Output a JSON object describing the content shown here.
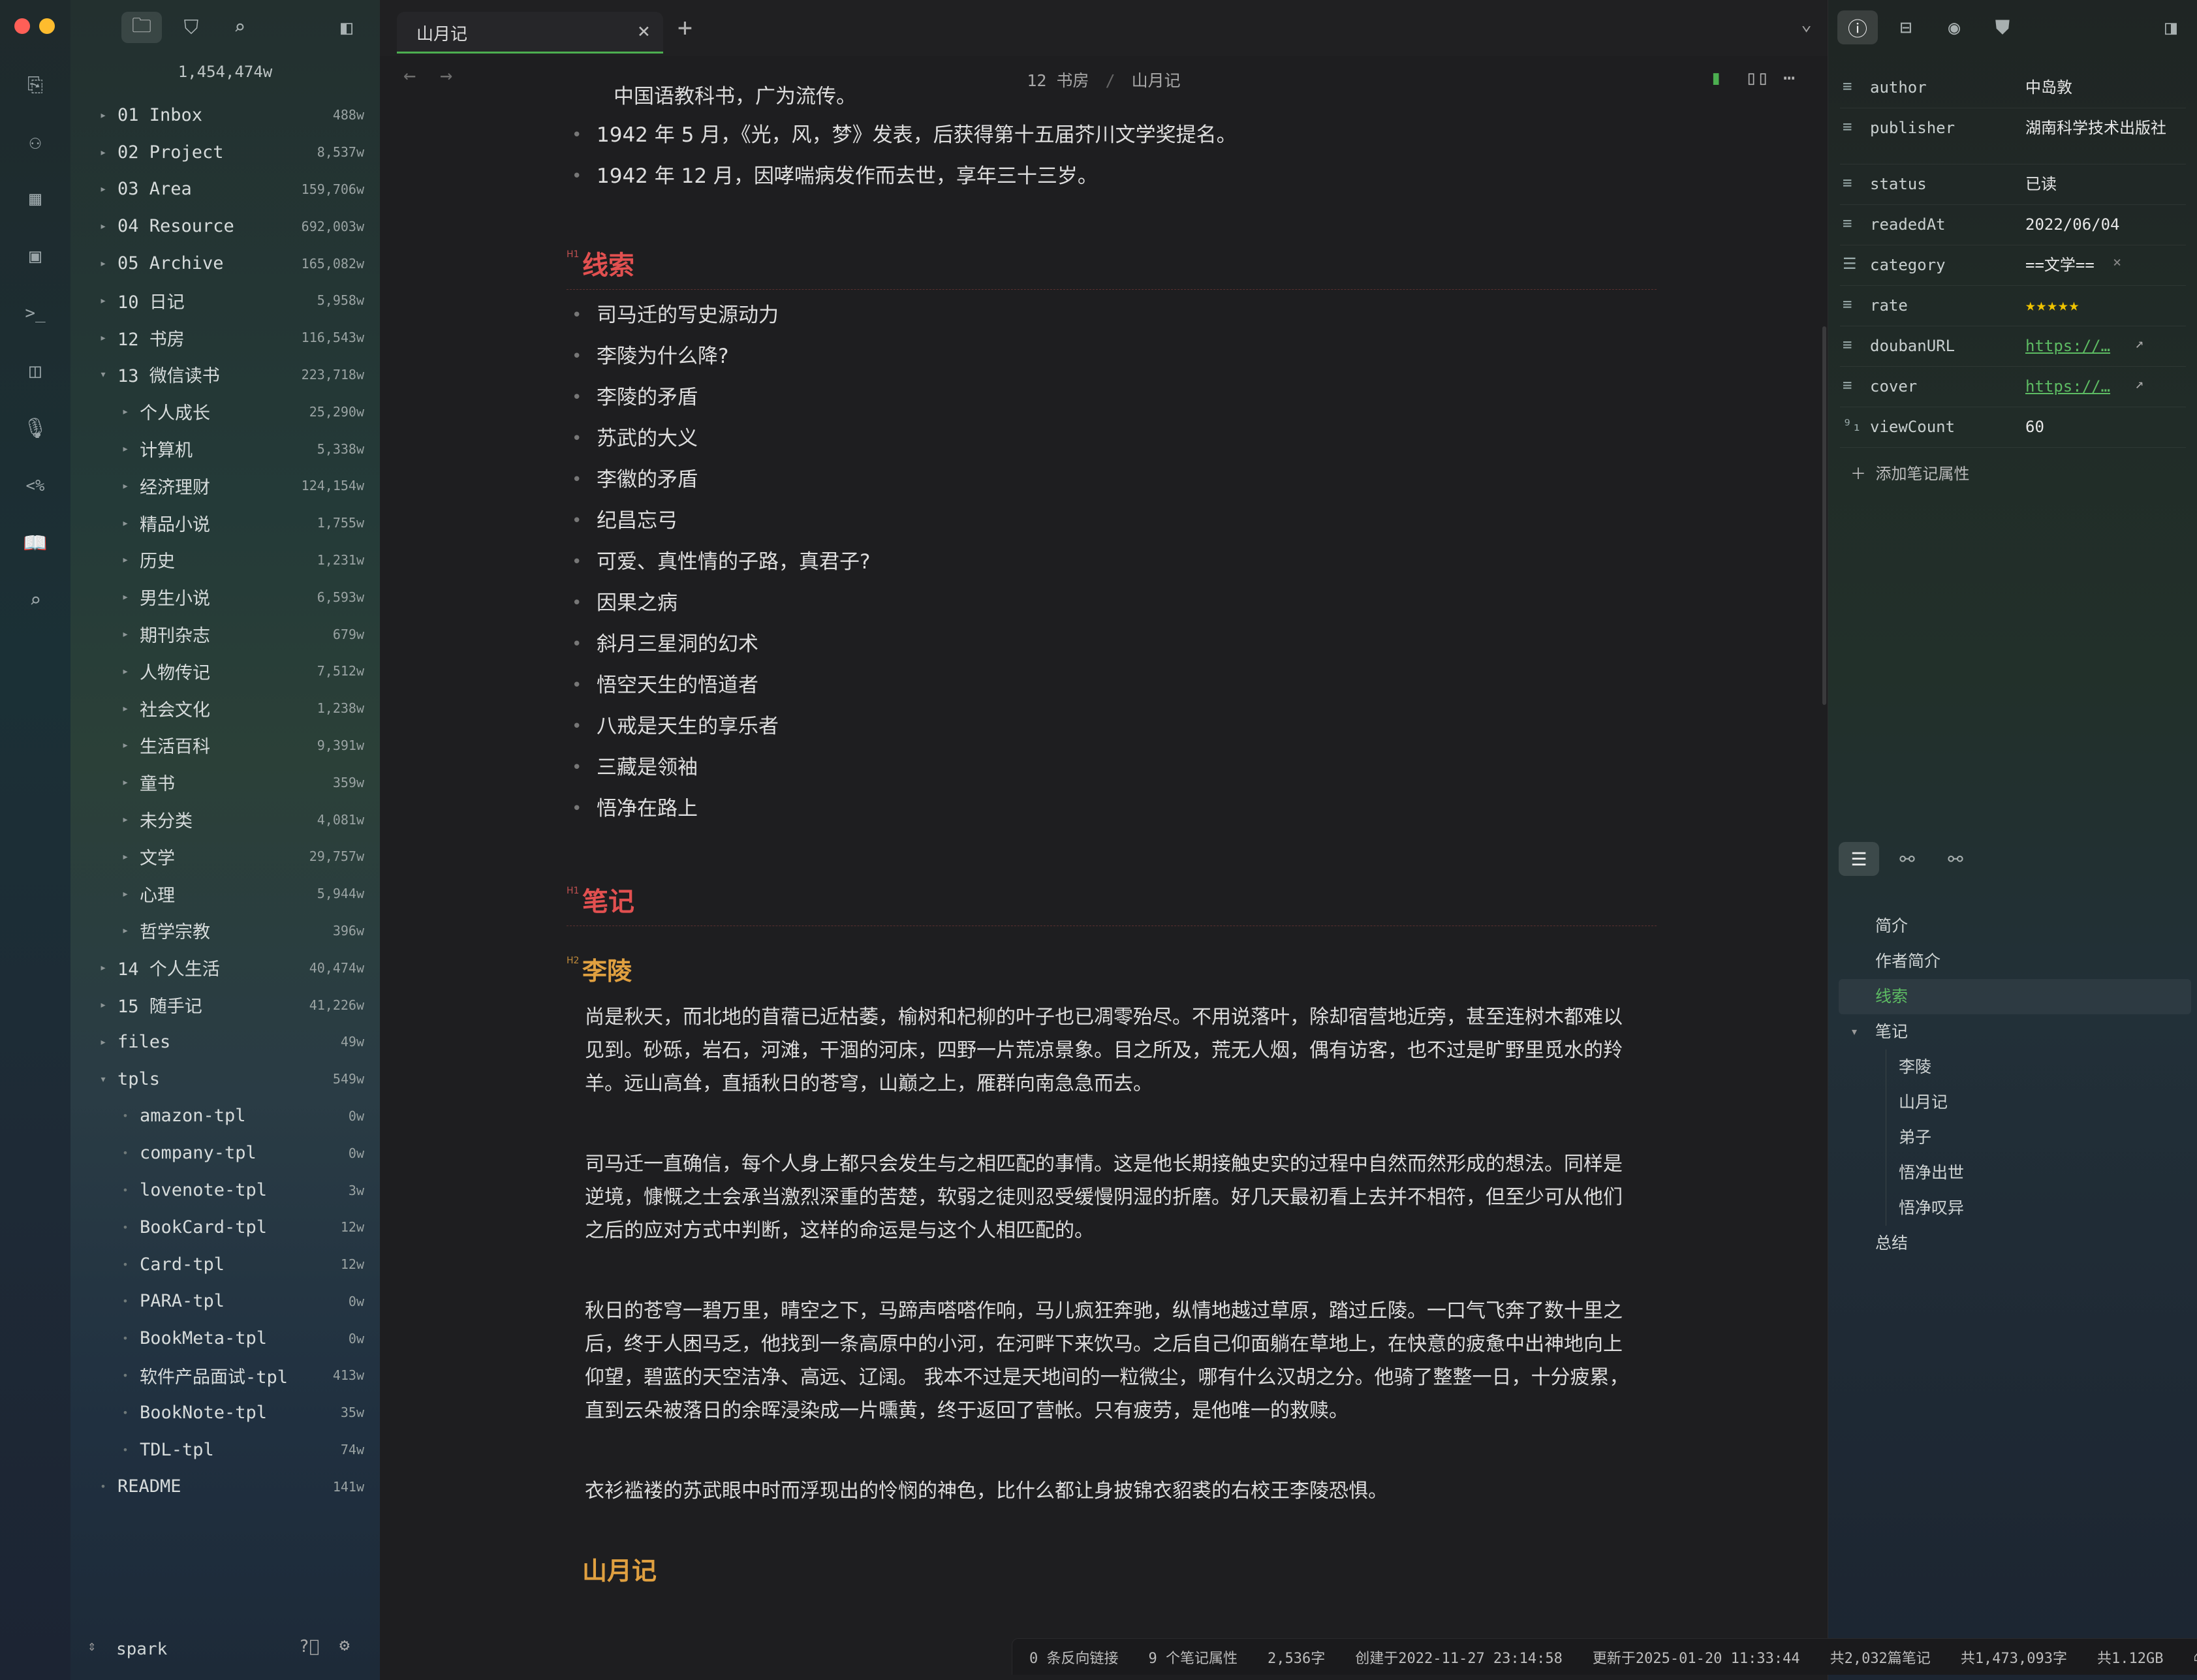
{
  "window": {
    "title": "山月记"
  },
  "sidebar": {
    "total_words": "1,454,474w",
    "items": [
      {
        "label": "01 Inbox",
        "count": "488w",
        "level": 0,
        "kind": "folder",
        "open": false
      },
      {
        "label": "02 Project",
        "count": "8,537w",
        "level": 0,
        "kind": "folder",
        "open": false
      },
      {
        "label": "03 Area",
        "count": "159,706w",
        "level": 0,
        "kind": "folder",
        "open": false
      },
      {
        "label": "04 Resource",
        "count": "692,003w",
        "level": 0,
        "kind": "folder",
        "open": false
      },
      {
        "label": "05 Archive",
        "count": "165,082w",
        "level": 0,
        "kind": "folder",
        "open": false
      },
      {
        "label": "10 日记",
        "count": "5,958w",
        "level": 0,
        "kind": "folder",
        "open": false
      },
      {
        "label": "12 书房",
        "count": "116,543w",
        "level": 0,
        "kind": "folder",
        "open": false
      },
      {
        "label": "13 微信读书",
        "count": "223,718w",
        "level": 0,
        "kind": "folder",
        "open": true
      },
      {
        "label": "个人成长",
        "count": "25,290w",
        "level": 1,
        "kind": "folder",
        "open": false
      },
      {
        "label": "计算机",
        "count": "5,338w",
        "level": 1,
        "kind": "folder",
        "open": false
      },
      {
        "label": "经济理财",
        "count": "124,154w",
        "level": 1,
        "kind": "folder",
        "open": false
      },
      {
        "label": "精品小说",
        "count": "1,755w",
        "level": 1,
        "kind": "folder",
        "open": false
      },
      {
        "label": "历史",
        "count": "1,231w",
        "level": 1,
        "kind": "folder",
        "open": false
      },
      {
        "label": "男生小说",
        "count": "6,593w",
        "level": 1,
        "kind": "folder",
        "open": false
      },
      {
        "label": "期刊杂志",
        "count": "679w",
        "level": 1,
        "kind": "folder",
        "open": false
      },
      {
        "label": "人物传记",
        "count": "7,512w",
        "level": 1,
        "kind": "folder",
        "open": false
      },
      {
        "label": "社会文化",
        "count": "1,238w",
        "level": 1,
        "kind": "folder",
        "open": false
      },
      {
        "label": "生活百科",
        "count": "9,391w",
        "level": 1,
        "kind": "folder",
        "open": false
      },
      {
        "label": "童书",
        "count": "359w",
        "level": 1,
        "kind": "folder",
        "open": false
      },
      {
        "label": "未分类",
        "count": "4,081w",
        "level": 1,
        "kind": "folder",
        "open": false
      },
      {
        "label": "文学",
        "count": "29,757w",
        "level": 1,
        "kind": "folder",
        "open": false
      },
      {
        "label": "心理",
        "count": "5,944w",
        "level": 1,
        "kind": "folder",
        "open": false
      },
      {
        "label": "哲学宗教",
        "count": "396w",
        "level": 1,
        "kind": "folder",
        "open": false
      },
      {
        "label": "14 个人生活",
        "count": "40,474w",
        "level": 0,
        "kind": "folder",
        "open": false
      },
      {
        "label": "15 随手记",
        "count": "41,226w",
        "level": 0,
        "kind": "folder",
        "open": false
      },
      {
        "label": "files",
        "count": "49w",
        "level": 0,
        "kind": "folder",
        "open": false
      },
      {
        "label": "tpls",
        "count": "549w",
        "level": 0,
        "kind": "folder",
        "open": true
      },
      {
        "label": "amazon-tpl",
        "count": "0w",
        "level": 1,
        "kind": "file"
      },
      {
        "label": "company-tpl",
        "count": "0w",
        "level": 1,
        "kind": "file"
      },
      {
        "label": "lovenote-tpl",
        "count": "3w",
        "level": 1,
        "kind": "file"
      },
      {
        "label": "BookCard-tpl",
        "count": "12w",
        "level": 1,
        "kind": "file"
      },
      {
        "label": "Card-tpl",
        "count": "12w",
        "level": 1,
        "kind": "file"
      },
      {
        "label": "PARA-tpl",
        "count": "0w",
        "level": 1,
        "kind": "file"
      },
      {
        "label": "BookMeta-tpl",
        "count": "0w",
        "level": 1,
        "kind": "file"
      },
      {
        "label": "软件产品面试-tpl",
        "count": "413w",
        "level": 1,
        "kind": "file"
      },
      {
        "label": "BookNote-tpl",
        "count": "35w",
        "level": 1,
        "kind": "file"
      },
      {
        "label": "TDL-tpl",
        "count": "74w",
        "level": 1,
        "kind": "file"
      },
      {
        "label": "README",
        "count": "141w",
        "level": 0,
        "kind": "file"
      }
    ],
    "vault_name": "spark"
  },
  "tabs": [
    {
      "label": "山月记",
      "active": true
    }
  ],
  "breadcrumb": {
    "folder": "12 书房",
    "separator": "/",
    "note": "山月记"
  },
  "doc": {
    "top_fragment": "中国语教科书，广为流传。",
    "intro_items": [
      "1942 年 5 月，《光，风，梦》发表，后获得第十五届芥川文学奖提名。",
      "1942 年 12 月，因哮喘病发作而去世，享年三十三岁。"
    ],
    "h1_clues": "线索",
    "clues": [
      "司马迁的写史源动力",
      "李陵为什么降?",
      "李陵的矛盾",
      "苏武的大义",
      "李徽的矛盾",
      "纪昌忘弓",
      "可爱、真性情的子路，真君子?",
      "因果之病",
      "斜月三星洞的幻术",
      "悟空天生的悟道者",
      "八戒是天生的享乐者",
      "三藏是领袖",
      "悟净在路上"
    ],
    "h1_notes": "笔记",
    "h2_lingling": "李陵",
    "h1_level_label": "H1",
    "h2_level_label": "H2",
    "paragraphs": [
      "尚是秋天，而北地的苜蓿已近枯萎，榆树和杞柳的叶子也已凋零殆尽。不用说落叶，除却宿营地近旁，甚至连树木都难以见到。砂砾，岩石，河滩，干涸的河床，四野一片荒凉景象。目之所及，荒无人烟，偶有访客，也不过是旷野里觅水的羚羊。远山高耸，直插秋日的苍穹，山巅之上，雁群向南急急而去。",
      "司马迁一直确信，每个人身上都只会发生与之相匹配的事情。这是他长期接触史实的过程中自然而然形成的想法。同样是逆境，慷慨之士会承当激烈深重的苦楚，软弱之徒则忍受缓慢阴湿的折磨。好几天最初看上去并不相符，但至少可从他们之后的应对方式中判断，这样的命运是与这个人相匹配的。",
      "秋日的苍穹一碧万里，晴空之下，马蹄声嗒嗒作响，马儿疯狂奔驰，纵情地越过草原，踏过丘陵。一口气飞奔了数十里之后，终于人困马乏，他找到一条高原中的小河，在河畔下来饮马。之后自己仰面躺在草地上，在快意的疲惫中出神地向上仰望，碧蓝的天空洁净、高远、辽阔。 我本不过是天地间的一粒微尘，哪有什么汉胡之分。他骑了整整一日，十分疲累，直到云朵被落日的余晖浸染成一片曛黄，终于返回了营帐。只有疲劳，是他唯一的救赎。",
      "衣衫褴褛的苏武眼中时而浮现出的怜悯的神色，比什么都让身披锦衣貂裘的右校王李陵恐惧。"
    ],
    "bottom_fragment": "山月记"
  },
  "status": {
    "backlinks": "0 条反向链接",
    "props": "9 个笔记属性",
    "chars": "2,536字",
    "created": "创建于2022-11-27 23:14:58",
    "updated": "更新于2025-01-20 11:33:44",
    "notes_total": "共2,032篇笔记",
    "words_total": "共1,473,093字",
    "size_total": "共1.12GB"
  },
  "properties": [
    {
      "key": "author",
      "value": "中岛敦",
      "icon": "text-icon",
      "type": "text"
    },
    {
      "key": "publisher",
      "value": "湖南科学技术出版社",
      "icon": "text-icon",
      "type": "text"
    },
    {
      "key": "status",
      "value": "已读",
      "icon": "text-icon",
      "type": "text"
    },
    {
      "key": "readedAt",
      "value": "2022/06/04",
      "icon": "text-icon",
      "type": "text"
    },
    {
      "key": "category",
      "value": "==文学==",
      "icon": "list-icon",
      "type": "tag"
    },
    {
      "key": "rate",
      "value": "★★★★★",
      "icon": "text-icon",
      "type": "stars"
    },
    {
      "key": "doubanURL",
      "value": "https://…",
      "icon": "text-icon",
      "type": "link"
    },
    {
      "key": "cover",
      "value": "https://…",
      "icon": "text-icon",
      "type": "link"
    },
    {
      "key": "viewCount",
      "value": "60",
      "icon": "number-icon",
      "type": "text"
    }
  ],
  "add_property_label": "添加笔记属性",
  "outline": [
    {
      "label": "简介",
      "level": 0
    },
    {
      "label": "作者简介",
      "level": 0
    },
    {
      "label": "线索",
      "level": 0,
      "active": true
    },
    {
      "label": "笔记",
      "level": 0,
      "open": true
    },
    {
      "label": "李陵",
      "level": 1
    },
    {
      "label": "山月记",
      "level": 1
    },
    {
      "label": "弟子",
      "level": 1
    },
    {
      "label": "悟净出世",
      "level": 1
    },
    {
      "label": "悟净叹异",
      "level": 1
    },
    {
      "label": "总结",
      "level": 0
    }
  ],
  "colors": {
    "accent": "#4caf50",
    "h1": "#e25050",
    "h2": "#e0a040",
    "link": "#5dbb63",
    "star": "#f0c400"
  }
}
